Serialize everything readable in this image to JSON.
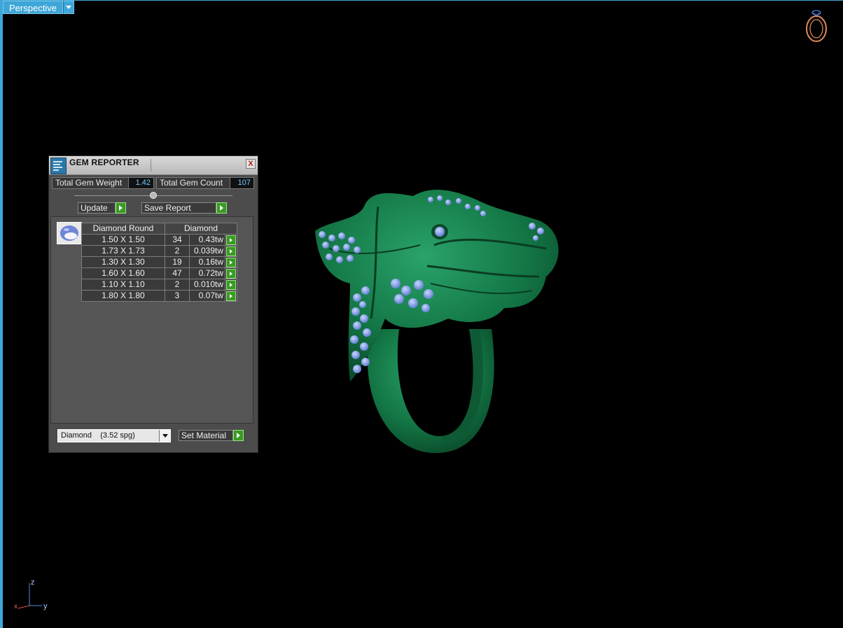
{
  "viewport": {
    "view_mode_label": "Perspective",
    "axes": {
      "z": "z",
      "x": "x",
      "y": "y"
    }
  },
  "gem_reporter": {
    "title": "GEM REPORTER",
    "close_label": "X",
    "total_weight_label": "Total Gem Weight",
    "total_weight_value": "1.42",
    "total_count_label": "Total Gem Count",
    "total_count_value": "107",
    "update_label": "Update",
    "save_report_label": "Save Report",
    "table": {
      "header_shape": "Diamond Round",
      "header_material": "Diamond",
      "rows": [
        {
          "size": "1.50 X 1.50",
          "count": "34",
          "weight": "0.43tw"
        },
        {
          "size": "1.73 X 1.73",
          "count": "2",
          "weight": "0.039tw"
        },
        {
          "size": "1.30 X 1.30",
          "count": "19",
          "weight": "0.16tw"
        },
        {
          "size": "1.60 X 1.60",
          "count": "47",
          "weight": "0.72tw"
        },
        {
          "size": "1.10 X 1.10",
          "count": "2",
          "weight": "0.010tw"
        },
        {
          "size": "1.80 X 1.80",
          "count": "3",
          "weight": "0.07tw"
        }
      ]
    },
    "material_select_value": "Diamond    (3.52 spg)",
    "set_material_label": "Set Material"
  },
  "colors": {
    "accent": "#3ea6d8",
    "model_green": "#157a4a",
    "gem_blue": "#8aa6ea",
    "go_button": "#3a9a24"
  }
}
